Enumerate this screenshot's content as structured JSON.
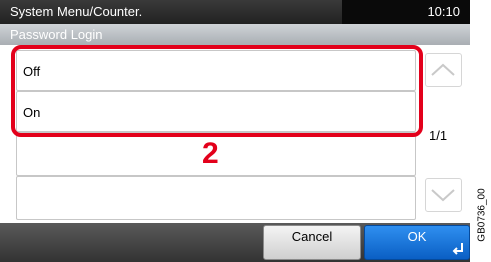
{
  "header": {
    "title": "System Menu/Counter.",
    "time": "10:10"
  },
  "subtitle": "Password Login",
  "options": [
    {
      "label": "Off"
    },
    {
      "label": "On"
    }
  ],
  "callout": "2",
  "pager": {
    "indicator": "1/1"
  },
  "footer": {
    "cancel_label": "Cancel",
    "ok_label": "OK"
  },
  "figure_code": "GB0736_00",
  "colors": {
    "highlight": "#e3001b",
    "ok_button": "#1a73d6",
    "title_bar": "#0a0a0a"
  }
}
